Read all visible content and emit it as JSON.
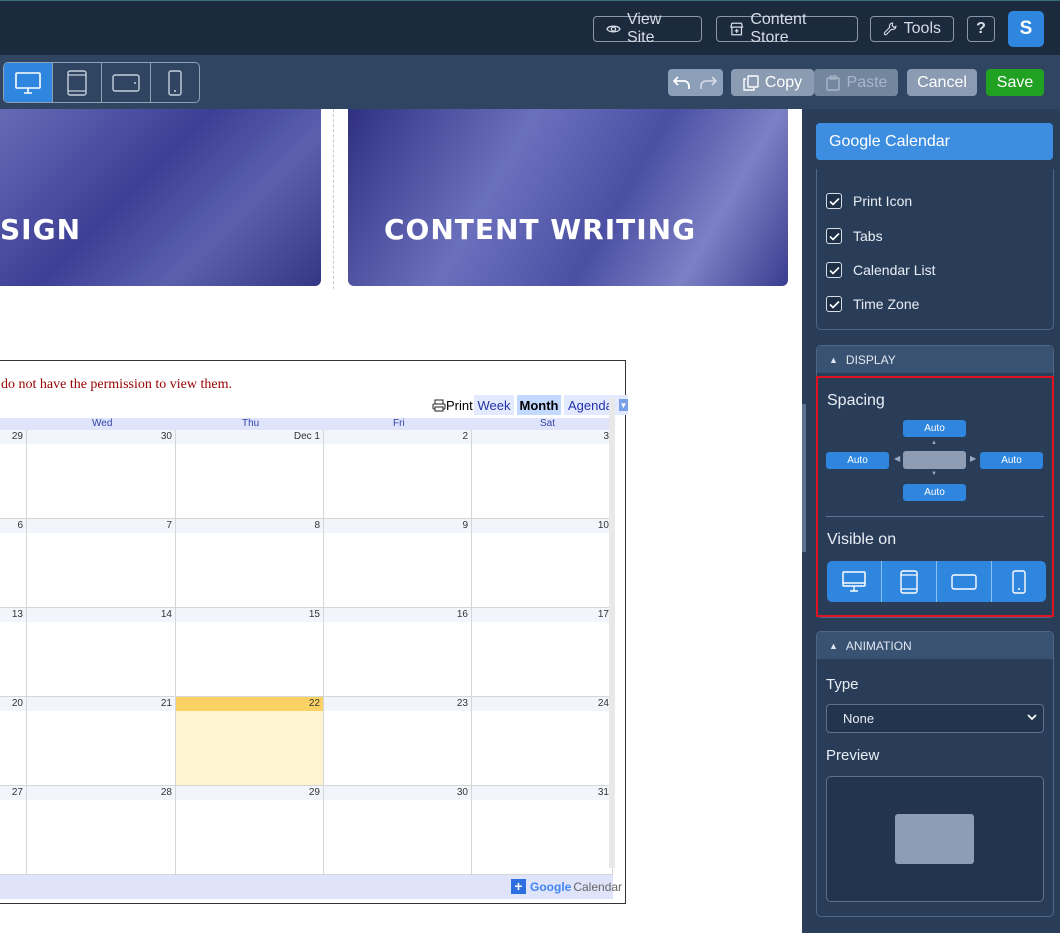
{
  "topbar": {
    "view_site": "View Site",
    "content_store": "Content Store",
    "tools": "Tools",
    "help": "?",
    "avatar": "S"
  },
  "toolbar": {
    "copy": "Copy",
    "paste": "Paste",
    "cancel": "Cancel",
    "save": "Save"
  },
  "canvas": {
    "left_card_title": "SIGN",
    "right_card_title": "CONTENT WRITING",
    "calendar": {
      "message": "do not have the permission to view them.",
      "print": "Print",
      "tabs": [
        "Week",
        "Month",
        "Agenda"
      ],
      "days": [
        "Wed",
        "Thu",
        "Fri",
        "Sat"
      ],
      "rows": [
        [
          "29",
          "30",
          "Dec 1",
          "2",
          "3"
        ],
        [
          "6",
          "7",
          "8",
          "9",
          "10"
        ],
        [
          "13",
          "14",
          "15",
          "16",
          "17"
        ],
        [
          "20",
          "21",
          "22",
          "23",
          "24"
        ],
        [
          "27",
          "28",
          "29",
          "30",
          "31"
        ]
      ],
      "footer_google": "Google",
      "footer_calendar": "Calendar",
      "colors": {
        "today": "#fff4d1",
        "today_header": "#fad163"
      }
    }
  },
  "sidebar": {
    "widget_title": "Google Calendar",
    "checkboxes": [
      "Print Icon",
      "Tabs",
      "Calendar List",
      "Time Zone"
    ],
    "display_header": "DISPLAY",
    "spacing_label": "Spacing",
    "spacing": {
      "top": "Auto",
      "left": "Auto",
      "right": "Auto",
      "bottom": "Auto"
    },
    "visible_on_label": "Visible on",
    "animation_header": "ANIMATION",
    "type_label": "Type",
    "type_value": "None",
    "preview_label": "Preview"
  },
  "colors": {
    "accent": "#2e86de",
    "save": "#21a121",
    "highlight": "#e0141e"
  }
}
